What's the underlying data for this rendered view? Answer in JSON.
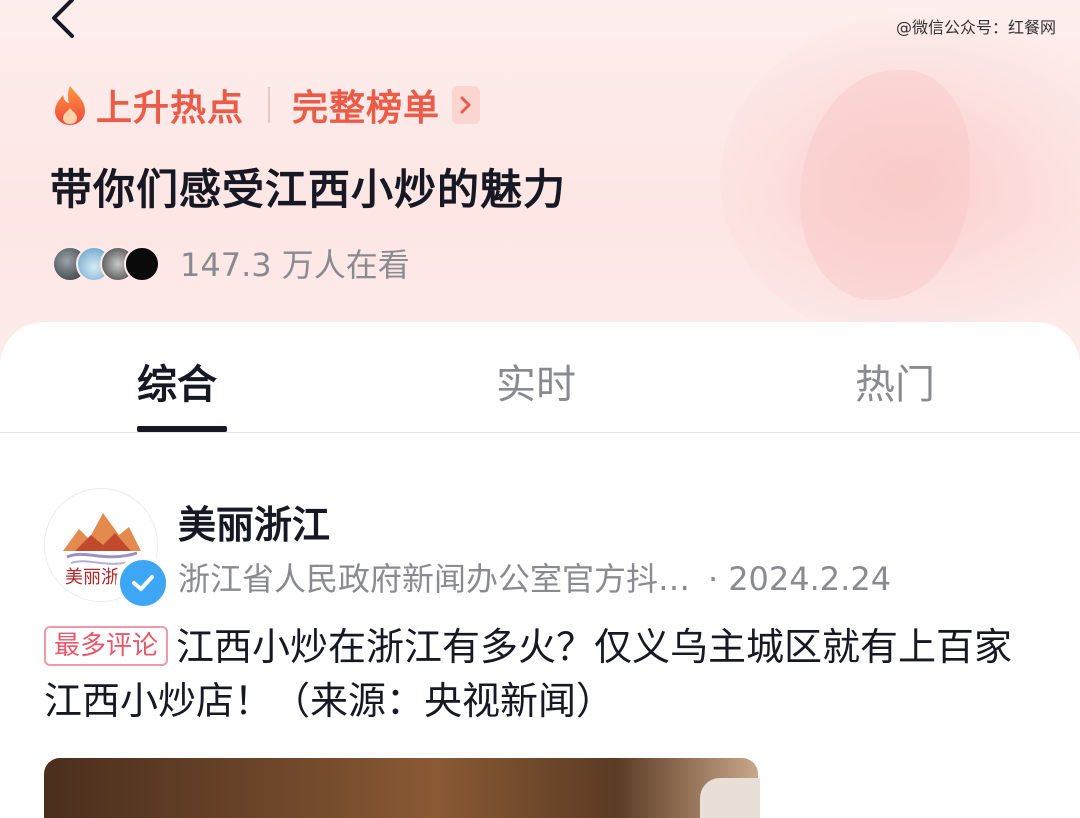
{
  "watermark": "@微信公众号：红餐网",
  "hot": {
    "label": "上升热点",
    "rank_link": "完整榜单"
  },
  "topic": {
    "title": "带你们感受江西小炒的魅力",
    "viewers": "147.3 万人在看"
  },
  "tabs": [
    {
      "label": "综合",
      "active": true
    },
    {
      "label": "实时",
      "active": false
    },
    {
      "label": "热门",
      "active": false
    }
  ],
  "post": {
    "author": "美丽浙江",
    "author_desc": "浙江省人民政府新闻办公室官方抖…",
    "date": "2024.2.24",
    "badge": "最多评论",
    "text": "江西小炒在浙江有多火？仅义乌主城区就有上百家江西小炒店！（来源：央视新闻）"
  },
  "colors": {
    "accent": "#ea5b48",
    "verified": "#3da7f5",
    "badge": "#e8576a"
  },
  "icons": [
    "back-arrow-icon",
    "flame-icon",
    "chevron-right-icon",
    "verified-check-icon"
  ]
}
